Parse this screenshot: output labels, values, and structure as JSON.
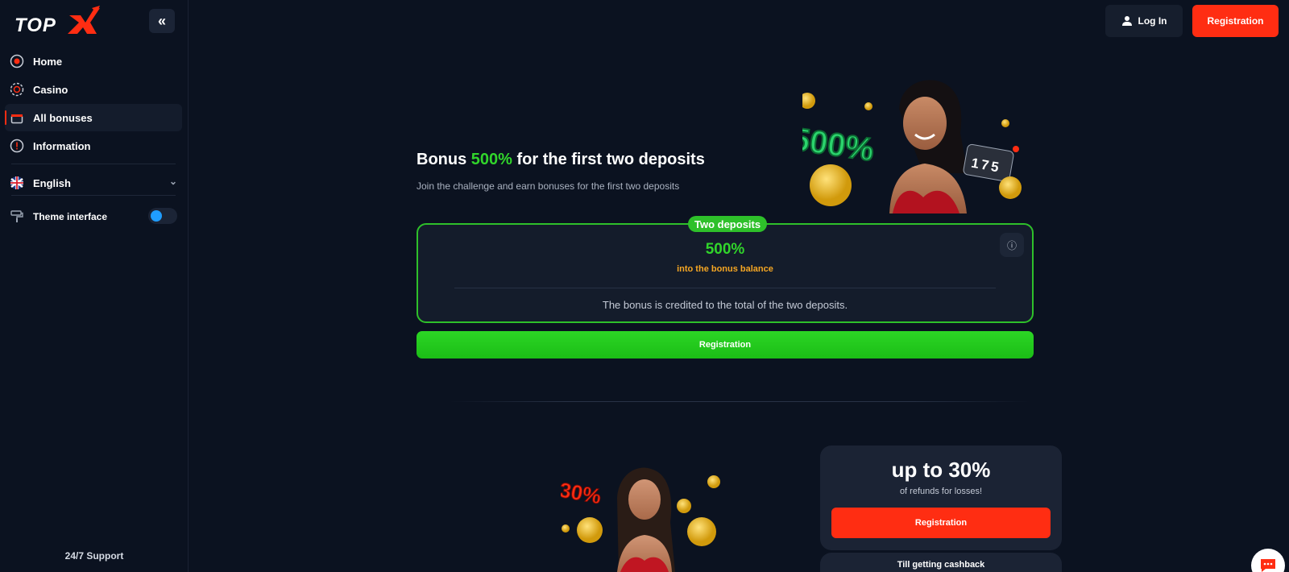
{
  "brand": {
    "logo_text": "TOPX",
    "accent": "#ff2d12"
  },
  "sidebar": {
    "items": [
      {
        "label": "Home",
        "icon": "home-icon"
      },
      {
        "label": "Casino",
        "icon": "casino-chip-icon"
      },
      {
        "label": "All bonuses",
        "icon": "gift-icon",
        "active": true
      },
      {
        "label": "Information",
        "icon": "info-icon"
      }
    ],
    "language": {
      "label": "English",
      "icon": "uk-flag-icon"
    },
    "theme": {
      "label": "Theme interface",
      "icon": "paint-roller-icon"
    },
    "support": "24/7 Support"
  },
  "header": {
    "login_label": "Log In",
    "register_label": "Registration"
  },
  "hero": {
    "title_pre": "Bonus ",
    "title_highlight": "500%",
    "title_post": " for the first two deposits",
    "subtitle": "Join the challenge and earn bonuses for the first two deposits",
    "art_text": "500%",
    "slot_digits": "175"
  },
  "deposit_card": {
    "badge": "Two deposits",
    "value": "500%",
    "label": "into the bonus balance",
    "note": "The bonus is credited to the total of the two deposits.",
    "button": "Registration"
  },
  "cashback": {
    "art_text": "30%",
    "value": "up to 30%",
    "label": "of refunds for losses!",
    "button": "Registration",
    "next_title": "Till getting cashback"
  },
  "colors": {
    "green": "#31d52b",
    "orange": "#f5a623",
    "red": "#ff2d12",
    "bg": "#0b1220",
    "card": "#141c2b"
  }
}
